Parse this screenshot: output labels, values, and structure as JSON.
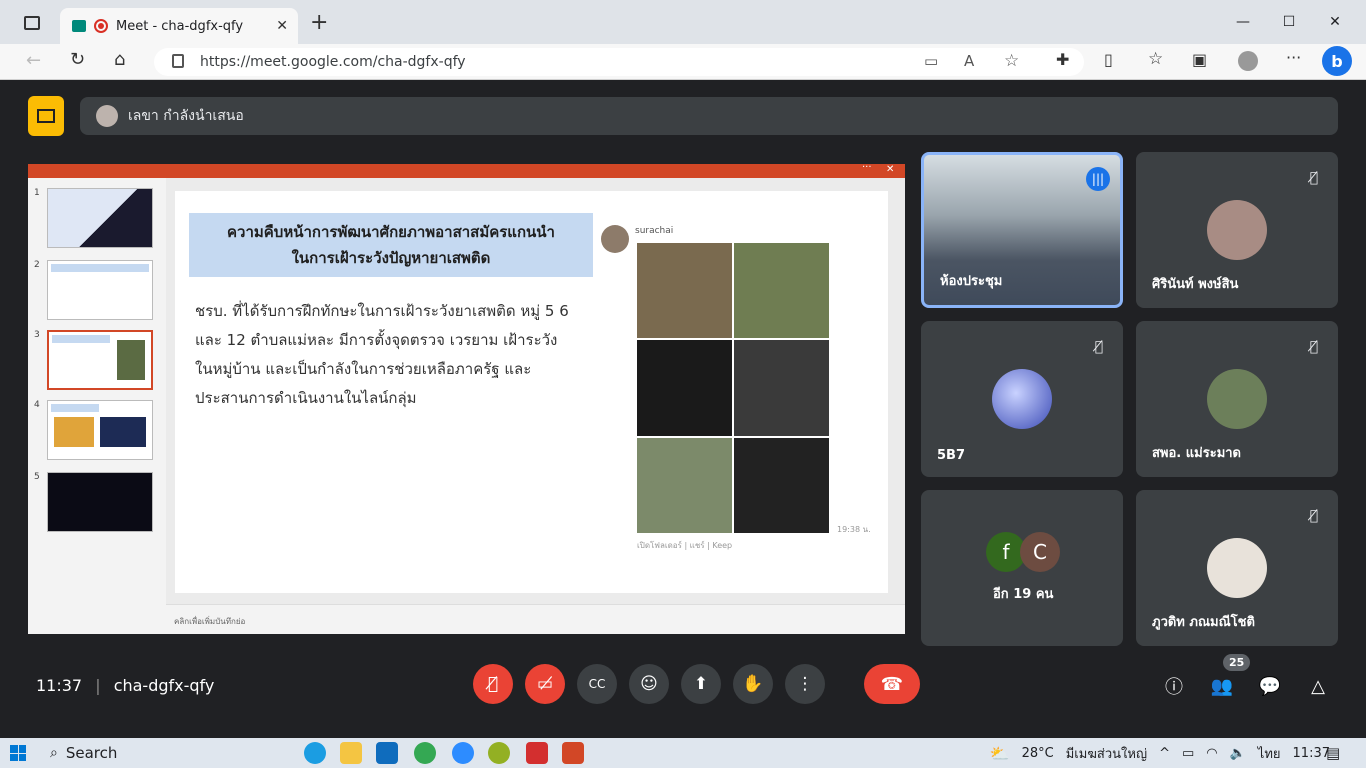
{
  "browser": {
    "tab_title": "Meet - cha-dgfx-qfy",
    "url": "https://meet.google.com/cha-dgfx-qfy",
    "new_tab_label": "+"
  },
  "meet": {
    "presenter_label": "เลขา กำลังนำเสนอ",
    "meeting_code": "cha-dgfx-qfy",
    "time": "11:37",
    "participant_count": "25",
    "colors": {
      "background": "#202124",
      "tile": "#3c4043",
      "end_call": "#ea4335",
      "present_badge": "#fbbc04"
    }
  },
  "slide": {
    "thumb_numbers": [
      "1",
      "2",
      "3",
      "4",
      "5"
    ],
    "active_thumb": "3",
    "title_line1": "ความคืบหน้าการพัฒนาศักยภาพอาสาสมัครแกนนำ",
    "title_line2": "ในการเฝ้าระวังปัญหายาเสพติด",
    "body_line1": "ชรบ. ที่ได้รับการฝึกทักษะในการเฝ้าระวังยาเสพติด หมู่ 5 6",
    "body_line2": "และ 12 ตำบลแม่หละ มีการตั้งจุดตรวจ เวรยาม เฝ้าระวัง",
    "body_line3": "ในหมู่บ้าน  และเป็นกำลังในการช่วยเหลือภาครัฐ และ",
    "body_line4": "ประสานการดำเนินงานในไลน์กลุ่ม",
    "chat_sender": "surachai",
    "chat_time": "19:38 น.",
    "chat_footer": "เปิดโฟลเดอร์ | แชร์ | Keep",
    "notes_placeholder": "คลิกเพื่อเพิ่มบันทึกย่อ"
  },
  "participants": [
    {
      "name": "ห้องประชุม",
      "speaking": true
    },
    {
      "name": "ศิรินันท์ พงษ์สิน",
      "muted": true
    },
    {
      "name": "5B7",
      "muted": true
    },
    {
      "name": "สพอ. แม่ระมาด",
      "muted": true
    },
    {
      "name": "อีก 19 คน",
      "initials": [
        "f",
        "C"
      ]
    },
    {
      "name": "ภูวดิท ภณมณีโชติ",
      "muted": true
    }
  ],
  "taskbar": {
    "search_label": "Search",
    "weather": "28°C",
    "weather_desc": "มีเมฆส่วนใหญ่",
    "language": "ไทย",
    "time": "11:37"
  }
}
